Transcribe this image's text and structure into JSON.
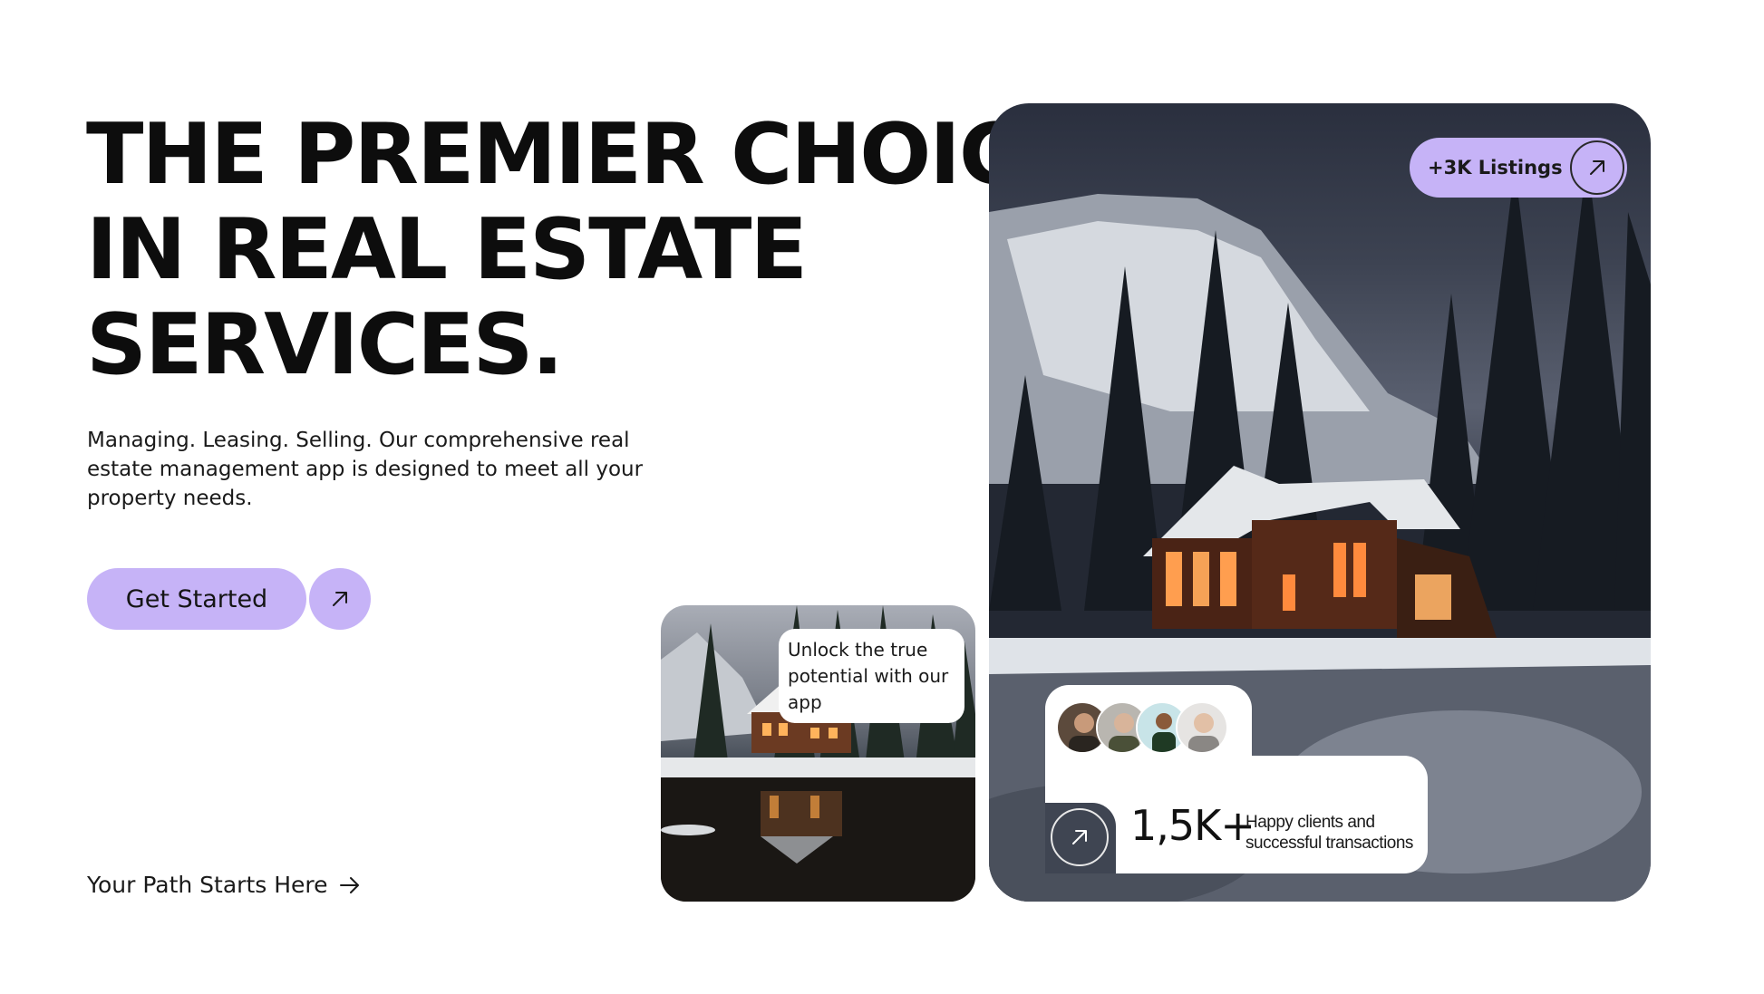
{
  "hero": {
    "headline_lines": [
      "THE PREMIER CHOICE",
      "IN REAL ESTATE",
      "SERVICES."
    ],
    "subtext": "Managing. Leasing. Selling. Our comprehensive real estate management app is designed to meet all your property needs.",
    "cta_label": "Get Started",
    "path_link_label": "Your Path Starts Here"
  },
  "small_card": {
    "bubble_text": "Unlock the true potential with our app"
  },
  "big_card": {
    "listings_label": "+3K Listings",
    "stats_number": "1,5K+",
    "stats_description": "Happy clients and successful transactions"
  },
  "colors": {
    "accent": "#c6b3f7",
    "text": "#0d0d0d",
    "background": "#ffffff"
  },
  "icons": {
    "cta_arrow": "arrow-up-right-icon",
    "path_arrow": "arrow-right-icon",
    "listings_arrow": "arrow-up-right-icon",
    "stats_arrow": "arrow-up-right-icon"
  }
}
